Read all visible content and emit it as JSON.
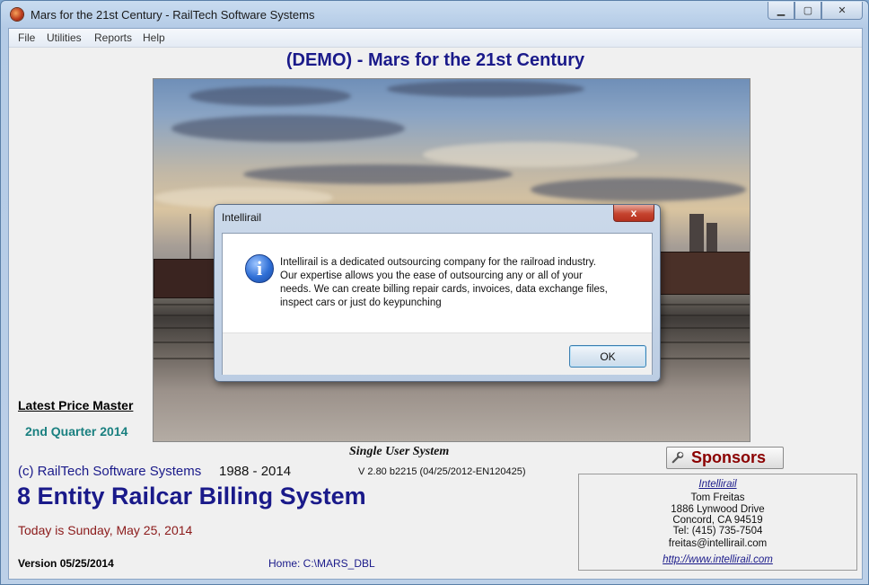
{
  "window": {
    "title": "Mars for the 21st Century - RailTech Software Systems"
  },
  "menu": {
    "items": [
      "File",
      "Utilities",
      "Reports",
      "Help"
    ]
  },
  "header": {
    "title": "(DEMO) - Mars for the 21st Century"
  },
  "left_panel": {
    "latest_price": "Latest Price Master",
    "quarter": "2nd Quarter 2014"
  },
  "main": {
    "single_user": "Single User System",
    "copyright": "(c) RailTech Software Systems",
    "years": "1988 - 2014",
    "version_info": "V 2.80  b2215 (04/25/2012-EN120425)",
    "system_title": "8 Entity Railcar Billing System",
    "today": "Today is Sunday, May 25, 2014",
    "version_date": "Version 05/25/2014",
    "home": "Home:  C:\\MARS_DBL"
  },
  "sponsors": {
    "button_label": "Sponsors",
    "name": "Intellirail",
    "contact": "Tom Freitas",
    "address1": "1886 Lynwood Drive",
    "address2": "Concord, CA 94519",
    "phone": "Tel: (415) 735-7504",
    "email": "freitas@intellirail.com",
    "website": "http://www.intellirail.com"
  },
  "dialog": {
    "title": "Intellirail",
    "message": "Intellirail is a dedicated outsourcing company for the railroad industry.\nOur expertise allows you the ease of outsourcing any or all of your\nneeds.  We can create billing repair cards, invoices, data  exchange files,\ninspect cars or just do keypunching",
    "ok_label": "OK",
    "close_glyph": "x"
  },
  "icons": {
    "app": "app-icon",
    "info": "info-icon",
    "wrench": "wrench-icon"
  },
  "colors": {
    "title_blue": "#1a1a8a",
    "sponsors_red": "#8b0000",
    "quarter_teal": "#1a8080",
    "date_red": "#8b1a1a"
  }
}
